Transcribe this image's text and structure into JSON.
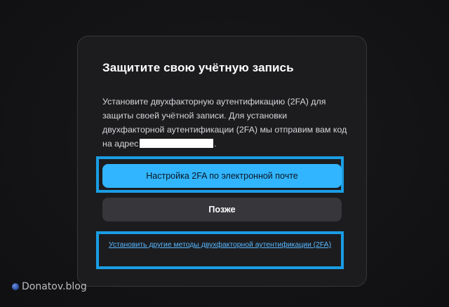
{
  "dialog": {
    "title": "Защитите свою учётную запись",
    "description_before": "Установите двухфакторную аутентификацию (2FA) для защиты своей учётной записи. Для установки двухфакторной аутентификации (2FA) мы отправим вам код на адрес",
    "description_after": ".",
    "primary_button_label": "Настройка 2FA по электронной почте",
    "secondary_button_label": "Позже",
    "other_methods_link": "Установить другие методы двухфакторной аутентификации (2FA)"
  },
  "watermark": {
    "text": "Donatov.blog"
  },
  "colors": {
    "background": "#141416",
    "modal": "#1c1c1f",
    "primary_button": "#32b5ff",
    "secondary_button": "#36363b",
    "highlight_frame": "#1a9de3",
    "link": "#58b8ff"
  }
}
